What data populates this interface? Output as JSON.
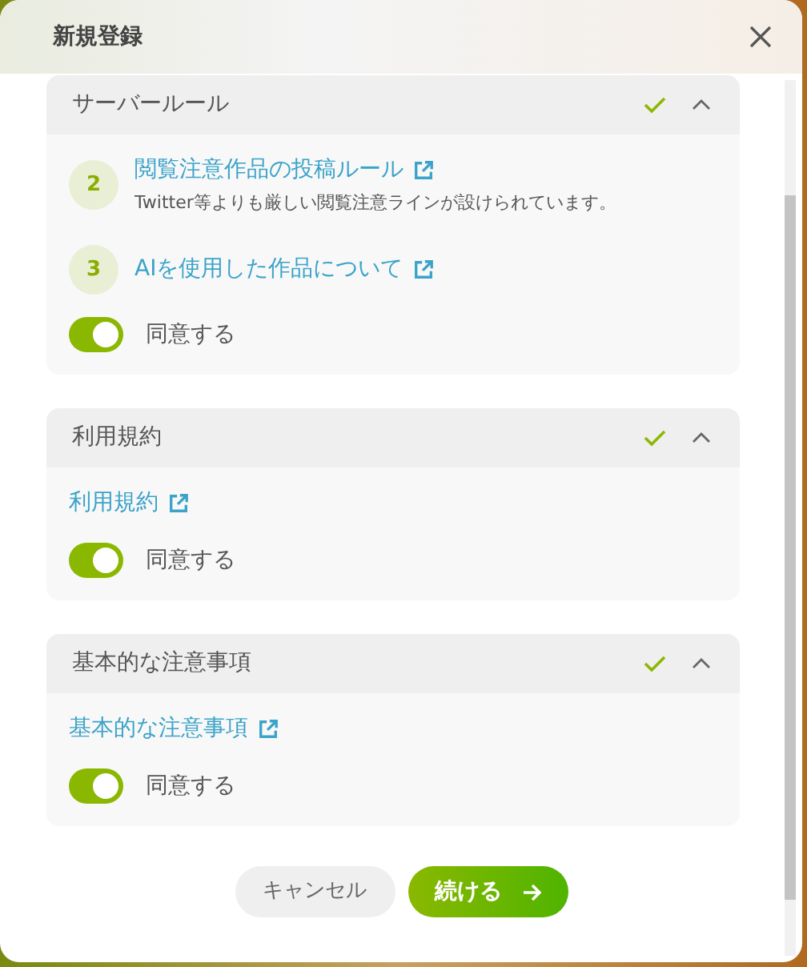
{
  "dialog": {
    "title": "新規登録"
  },
  "sections": [
    {
      "title": "サーバールール",
      "done": true,
      "expanded": true,
      "items": [
        {
          "number": "2",
          "title": "閲覧注意作品の投稿ルール",
          "description_lines": [
            "Twitter等よりも厳しい閲覧注意ラインが設けられています。"
          ]
        },
        {
          "number": "3",
          "title": "AIを使用した作品について"
        }
      ],
      "agree": {
        "label": "同意する",
        "on": true
      }
    },
    {
      "title": "利用規約",
      "done": true,
      "expanded": true,
      "link": "利用規約",
      "agree": {
        "label": "同意する",
        "on": true
      }
    },
    {
      "title": "基本的な注意事項",
      "done": true,
      "expanded": true,
      "link": "基本的な注意事項",
      "agree": {
        "label": "同意する",
        "on": true
      }
    }
  ],
  "buttons": [
    {
      "label": "キャンセル",
      "kind": "secondary"
    },
    {
      "label": "続ける",
      "kind": "primary"
    }
  ]
}
